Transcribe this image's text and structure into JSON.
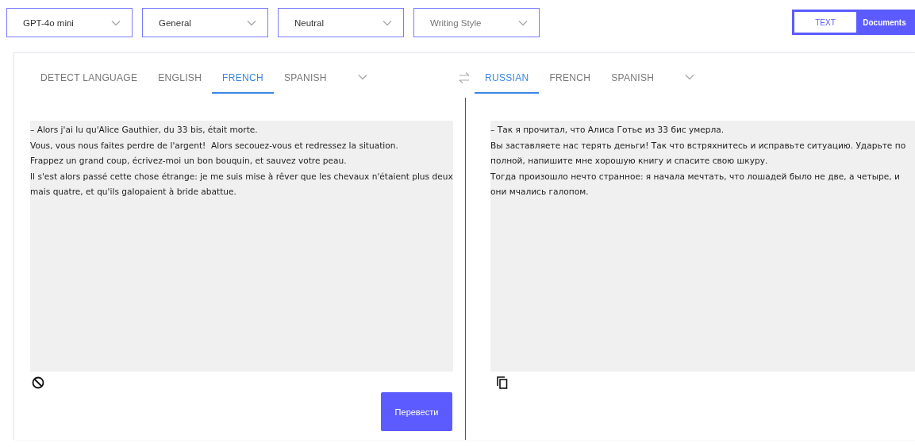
{
  "selects": [
    {
      "value": "GPT-4o mini"
    },
    {
      "value": "General"
    },
    {
      "value": "Neutral"
    },
    {
      "placeholder": "Writing Style"
    }
  ],
  "mode_toggle": [
    {
      "label": "TEXT",
      "selected": true
    },
    {
      "label": "Documents",
      "selected": false
    }
  ],
  "source": {
    "tabs": [
      {
        "label": "DETECT LANGUAGE",
        "selected": false
      },
      {
        "label": "ENGLISH",
        "selected": false
      },
      {
        "label": "FRENCH",
        "selected": true
      },
      {
        "label": "SPANISH",
        "selected": false
      }
    ],
    "text": "– Alors j'ai lu qu'Alice Gauthier, du 33 bis, était morte.\nVous, vous nous faites perdre de l'argent!  Alors secouez-vous et redressez la situation.\nFrappez un grand coup, écrivez-moi un bon bouquin, et sauvez votre peau.\nIl s'est alors passé cette chose étrange: je me suis mise à rêver que les chevaux n'étaient plus deux mais quatre, et qu'ils galopaient à bride abattue.",
    "button": "Перевести"
  },
  "target": {
    "tabs": [
      {
        "label": "RUSSIAN",
        "selected": true
      },
      {
        "label": "FRENCH",
        "selected": false
      },
      {
        "label": "SPANISH",
        "selected": false
      }
    ],
    "text": "– Так я прочитал, что Алиса Готье из 33 бис умерла.\nВы заставляете нас терять деньги! Так что встряхнитесь и исправьте ситуацию. Ударьте по полной, напишите мне хорошую книгу и спасите свою шкуру.\nТогда произошло нечто странное: я начала мечтать, что лошадей было не две, а четыре, и они мчались галопом."
  }
}
